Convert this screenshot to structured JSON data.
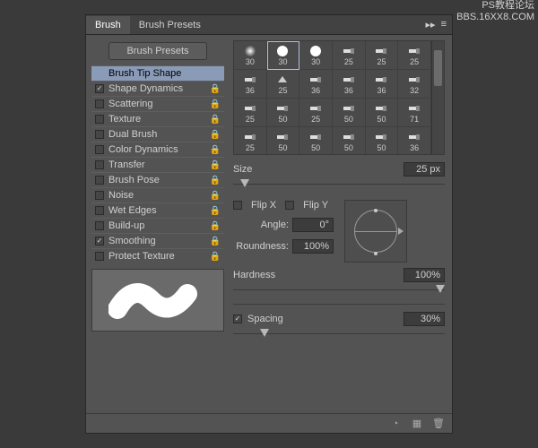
{
  "watermark": {
    "line1": "PS教程论坛",
    "line2": "BBS.16XX8.COM"
  },
  "tabs": {
    "brush": "Brush",
    "presets": "Brush Presets"
  },
  "sidebar": {
    "presets_btn": "Brush Presets",
    "items": [
      {
        "label": "Brush Tip Shape",
        "checkbox": false,
        "selected": true,
        "lock": false
      },
      {
        "label": "Shape Dynamics",
        "checkbox": true,
        "checked": true,
        "lock": true
      },
      {
        "label": "Scattering",
        "checkbox": true,
        "checked": false,
        "lock": true
      },
      {
        "label": "Texture",
        "checkbox": true,
        "checked": false,
        "lock": true
      },
      {
        "label": "Dual Brush",
        "checkbox": true,
        "checked": false,
        "lock": true
      },
      {
        "label": "Color Dynamics",
        "checkbox": true,
        "checked": false,
        "lock": true
      },
      {
        "label": "Transfer",
        "checkbox": true,
        "checked": false,
        "lock": true
      },
      {
        "label": "Brush Pose",
        "checkbox": true,
        "checked": false,
        "lock": true
      },
      {
        "label": "Noise",
        "checkbox": true,
        "checked": false,
        "lock": true
      },
      {
        "label": "Wet Edges",
        "checkbox": true,
        "checked": false,
        "lock": true
      },
      {
        "label": "Build-up",
        "checkbox": true,
        "checked": false,
        "lock": true
      },
      {
        "label": "Smoothing",
        "checkbox": true,
        "checked": true,
        "lock": true
      },
      {
        "label": "Protect Texture",
        "checkbox": true,
        "checked": false,
        "lock": true
      }
    ]
  },
  "swatches": [
    [
      {
        "l": "30",
        "t": "soft"
      },
      {
        "l": "30",
        "t": "hard",
        "sel": true
      },
      {
        "l": "30",
        "t": "hard"
      },
      {
        "l": "25",
        "t": "flat"
      },
      {
        "l": "25",
        "t": "flat"
      },
      {
        "l": "25",
        "t": "flat"
      }
    ],
    [
      {
        "l": "36",
        "t": "flat"
      },
      {
        "l": "25",
        "t": "fan"
      },
      {
        "l": "36",
        "t": "flat"
      },
      {
        "l": "36",
        "t": "flat"
      },
      {
        "l": "36",
        "t": "flat"
      },
      {
        "l": "32",
        "t": "flat"
      }
    ],
    [
      {
        "l": "25",
        "t": "flat"
      },
      {
        "l": "50",
        "t": "flat"
      },
      {
        "l": "25",
        "t": "flat"
      },
      {
        "l": "50",
        "t": "flat"
      },
      {
        "l": "50",
        "t": "flat"
      },
      {
        "l": "71",
        "t": "flat"
      }
    ],
    [
      {
        "l": "25",
        "t": "flat"
      },
      {
        "l": "50",
        "t": "flat"
      },
      {
        "l": "50",
        "t": "flat"
      },
      {
        "l": "50",
        "t": "flat"
      },
      {
        "l": "50",
        "t": "flat"
      },
      {
        "l": "36",
        "t": "flat"
      }
    ]
  ],
  "settings": {
    "size_label": "Size",
    "size_value": "25 px",
    "flipx_label": "Flip X",
    "flipx": false,
    "flipy_label": "Flip Y",
    "flipy": false,
    "angle_label": "Angle:",
    "angle_value": "0°",
    "roundness_label": "Roundness:",
    "roundness_value": "100%",
    "hardness_label": "Hardness",
    "hardness_value": "100%",
    "spacing_label": "Spacing",
    "spacing_checked": true,
    "spacing_value": "30%"
  }
}
